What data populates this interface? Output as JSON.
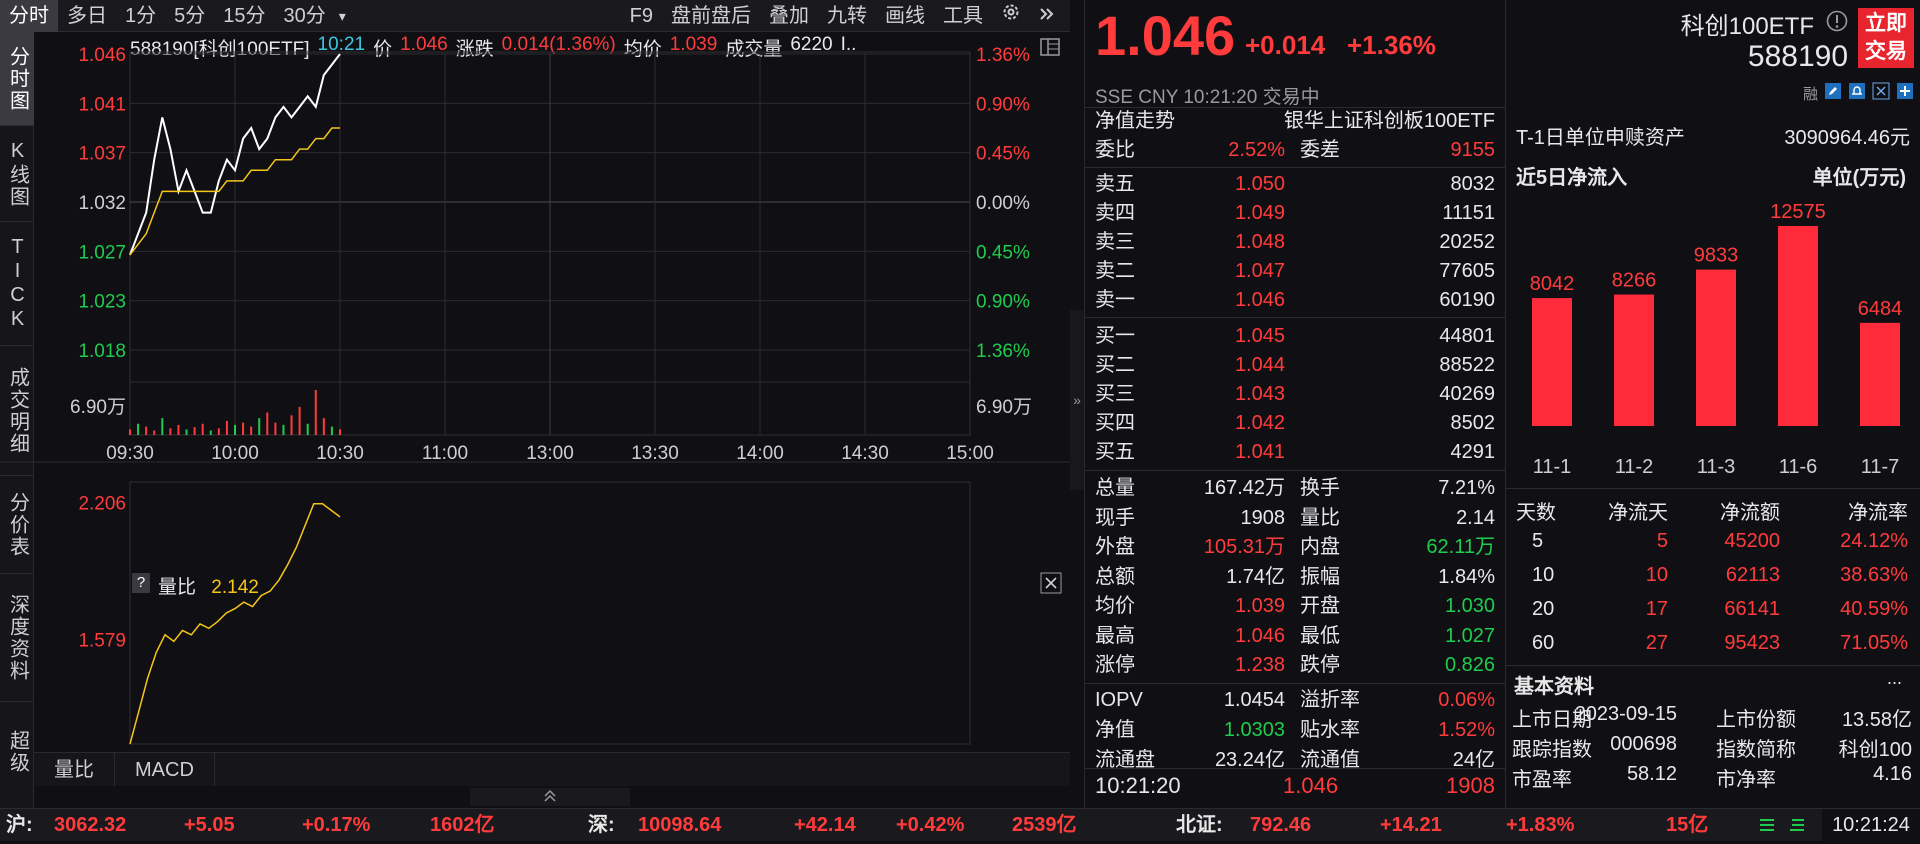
{
  "toolbar": {
    "tabs": [
      "分时",
      "多日",
      "1分",
      "5分",
      "15分",
      "30分"
    ],
    "dropdown": "▾",
    "right": [
      "F9",
      "盘前盘后",
      "叠加",
      "九转",
      "画线",
      "工具"
    ]
  },
  "vtabs": [
    "分时图",
    "K线图",
    "TICK",
    "成交明细",
    "分价表",
    "深度资料",
    "超级"
  ],
  "header": {
    "code_name": "588190[科创100ETF]",
    "time": "10:21",
    "price_label": "价",
    "price": "1.046",
    "change_label": "涨跌",
    "change": "0.014(1.36%)",
    "avg_label": "均价",
    "avg": "1.039",
    "vol_label": "成交量",
    "vol": "6220",
    "more": "I..."
  },
  "chart_data": [
    {
      "type": "line",
      "title": "",
      "y_ticks_left": [
        "1.046",
        "1.041",
        "1.037",
        "1.032",
        "1.027",
        "1.023",
        "1.018"
      ],
      "y_ticks_right": [
        "1.36%",
        "0.90%",
        "0.45%",
        "0.00%",
        "0.45%",
        "0.90%",
        "1.36%"
      ],
      "volume_tick": "6.90万",
      "x_ticks": [
        "09:30",
        "10:00",
        "10:30",
        "11:00",
        "13:00",
        "13:30",
        "14:00",
        "14:30",
        "15:00"
      ],
      "ylim": [
        1.018,
        1.046
      ],
      "series": [
        {
          "name": "价",
          "values": [
            1.027,
            1.029,
            1.031,
            1.036,
            1.04,
            1.037,
            1.033,
            1.035,
            1.033,
            1.031,
            1.031,
            1.034,
            1.036,
            1.035,
            1.038,
            1.039,
            1.037,
            1.038,
            1.04,
            1.041,
            1.04,
            1.041,
            1.042,
            1.041,
            1.044,
            1.045,
            1.046
          ]
        },
        {
          "name": "均价",
          "values": [
            1.027,
            1.028,
            1.029,
            1.031,
            1.033,
            1.033,
            1.033,
            1.033,
            1.033,
            1.033,
            1.033,
            1.033,
            1.034,
            1.034,
            1.034,
            1.035,
            1.035,
            1.035,
            1.036,
            1.036,
            1.036,
            1.037,
            1.037,
            1.038,
            1.038,
            1.039,
            1.039
          ]
        }
      ],
      "volumes": [
        10,
        20,
        15,
        8,
        30,
        12,
        18,
        10,
        14,
        20,
        8,
        12,
        25,
        18,
        22,
        15,
        30,
        40,
        22,
        18,
        35,
        50,
        20,
        80,
        30,
        15,
        10
      ]
    },
    {
      "type": "line",
      "title": "量比",
      "value": "2.142",
      "y_ticks": [
        "2.206",
        "1.579"
      ],
      "ylim": [
        1.1,
        2.3
      ],
      "series": [
        {
          "name": "量比",
          "values": [
            1.1,
            1.25,
            1.4,
            1.52,
            1.6,
            1.57,
            1.62,
            1.6,
            1.65,
            1.63,
            1.66,
            1.7,
            1.72,
            1.75,
            1.73,
            1.78,
            1.8,
            1.85,
            1.92,
            2.0,
            2.1,
            2.2,
            2.2,
            2.17,
            2.14
          ]
        }
      ]
    }
  ],
  "mini_tabs": [
    "量比",
    "MACD"
  ],
  "quote": {
    "price": "1.046",
    "change": "+0.014",
    "pct": "+1.36%",
    "name": "科创100ETF",
    "code": "588190",
    "trade_btn": "立即交易",
    "market_line": "SSE  CNY  10:21:20  交易中",
    "nav_label": "净值走势",
    "fund_name": "银华上证科创板100ETF",
    "wb_label": "委比",
    "wb": "2.52%",
    "wc_label": "委差",
    "wc": "9155",
    "asks": [
      [
        "卖五",
        "1.050",
        "8032"
      ],
      [
        "卖四",
        "1.049",
        "11151"
      ],
      [
        "卖三",
        "1.048",
        "20252"
      ],
      [
        "卖二",
        "1.047",
        "77605"
      ],
      [
        "卖一",
        "1.046",
        "60190"
      ]
    ],
    "bids": [
      [
        "买一",
        "1.045",
        "44801"
      ],
      [
        "买二",
        "1.044",
        "88522"
      ],
      [
        "买三",
        "1.043",
        "40269"
      ],
      [
        "买四",
        "1.042",
        "8502"
      ],
      [
        "买五",
        "1.041",
        "4291"
      ]
    ],
    "stats": [
      [
        "总量",
        "167.42万",
        "white",
        "换手",
        "7.21%",
        "white"
      ],
      [
        "现手",
        "1908",
        "white",
        "量比",
        "2.14",
        "white"
      ],
      [
        "外盘",
        "105.31万",
        "red",
        "内盘",
        "62.11万",
        "green"
      ],
      [
        "总额",
        "1.74亿",
        "white",
        "振幅",
        "1.84%",
        "white"
      ],
      [
        "均价",
        "1.039",
        "red",
        "开盘",
        "1.030",
        "green"
      ],
      [
        "最高",
        "1.046",
        "red",
        "最低",
        "1.027",
        "green"
      ],
      [
        "涨停",
        "1.238",
        "red",
        "跌停",
        "0.826",
        "green"
      ]
    ],
    "iopv": [
      [
        "IOPV",
        "1.0454",
        "white",
        "溢折率",
        "0.06%",
        "red"
      ],
      [
        "净值",
        "1.0303",
        "green",
        "贴水率",
        "1.52%",
        "red"
      ],
      [
        "流通盘",
        "23.24亿",
        "white",
        "流通值",
        "24亿",
        "white"
      ]
    ],
    "last_tick": [
      "10:21:20",
      "1.046",
      "1908"
    ]
  },
  "etf": {
    "t1_label": "T-1日单位申赎资产",
    "t1_value": "3090964.46元",
    "flow_title": "近5日净流入",
    "flow_unit": "单位(万元)",
    "flow": {
      "categories": [
        "11-1",
        "11-2",
        "11-3",
        "11-6",
        "11-7"
      ],
      "values": [
        8042,
        8266,
        9833,
        12575,
        6484
      ]
    },
    "table_head": [
      "天数",
      "净流天",
      "净流额",
      "净流率"
    ],
    "table": [
      [
        "5",
        "5",
        "45200",
        "24.12%"
      ],
      [
        "10",
        "10",
        "62113",
        "38.63%"
      ],
      [
        "20",
        "17",
        "66141",
        "40.59%"
      ],
      [
        "60",
        "27",
        "95423",
        "71.05%"
      ]
    ],
    "basic_title": "基本资料",
    "basic_more": "...",
    "basic": [
      [
        "上市日期",
        "2023-09-15",
        "上市份额",
        "13.58亿"
      ],
      [
        "跟踪指数",
        "000698",
        "指数简称",
        "科创100"
      ],
      [
        "市盈率",
        "58.12",
        "市净率",
        "4.16"
      ]
    ]
  },
  "status": {
    "sh_label": "沪:",
    "sh": "3062.32",
    "sh_chg": "+5.05",
    "sh_pct": "+0.17%",
    "sh_amt": "1602亿",
    "sz_label": "深:",
    "sz": "10098.64",
    "sz_chg": "+42.14",
    "sz_pct": "+0.42%",
    "sz_amt": "2539亿",
    "bj_label": "北证:",
    "bj": "792.46",
    "bj_chg": "+14.21",
    "bj_pct": "+1.83%",
    "bj_amt": "15亿",
    "clock": "10:21:24"
  },
  "colors": {
    "up": "#ff3b3b",
    "down": "#1fcc4d",
    "price_line": "#ffffff",
    "avg_line": "#f5c518",
    "bar": "#ff2a3a"
  }
}
